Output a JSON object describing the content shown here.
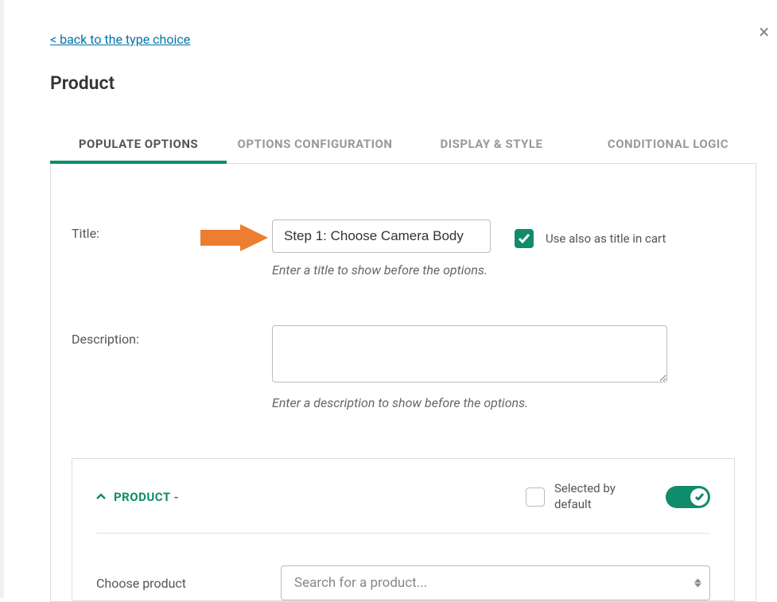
{
  "back_link": "< back to the type choice",
  "page_title": "Product",
  "tabs": {
    "populate": "POPULATE OPTIONS",
    "config": "OPTIONS CONFIGURATION",
    "display": "DISPLAY & STYLE",
    "conditional": "CONDITIONAL LOGIC"
  },
  "title_section": {
    "label": "Title:",
    "value": "Step 1: Choose Camera Body",
    "help": "Enter a title to show before the options.",
    "cart_label": "Use also as title in cart"
  },
  "description_section": {
    "label": "Description:",
    "value": "",
    "help": "Enter a description to show before the options."
  },
  "product_box": {
    "heading": "PRODUCT -",
    "selected_default": "Selected by default",
    "choose_label": "Choose product",
    "select_placeholder": "Search for a product..."
  }
}
